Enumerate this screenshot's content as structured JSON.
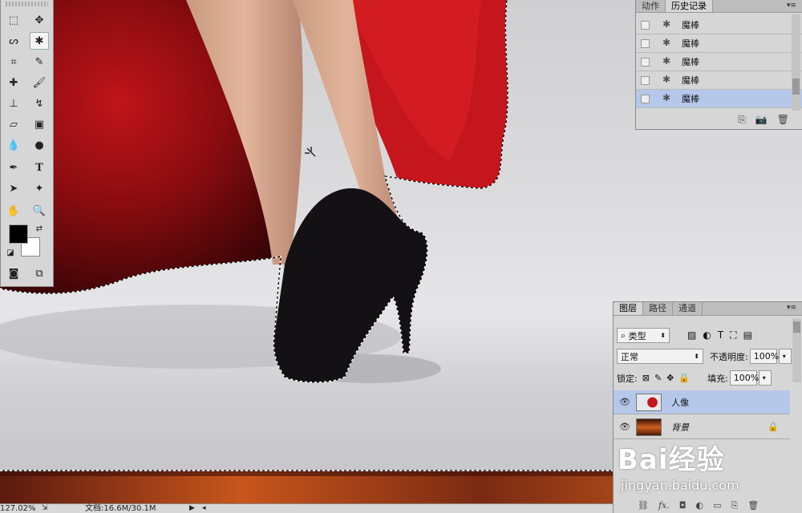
{
  "history_panel": {
    "tabs": [
      "动作",
      "历史记录"
    ],
    "items": [
      "魔棒",
      "魔棒",
      "魔棒",
      "魔棒",
      "魔棒"
    ],
    "selected_index": 4
  },
  "tools_panel": {
    "tools": [
      "marquee-tool",
      "move-tool",
      "lasso-tool",
      "magic-wand-tool",
      "crop-tool",
      "eyedropper-tool",
      "healing-brush-tool",
      "brush-tool",
      "clone-stamp-tool",
      "history-brush-tool",
      "eraser-tool",
      "gradient-tool",
      "blur-tool",
      "dodge-tool",
      "pen-tool",
      "type-tool",
      "path-selection-tool",
      "shape-tool",
      "hand-tool",
      "zoom-tool"
    ],
    "type_tool_glyph": "T",
    "foreground_color": "#000000",
    "background_color": "#ffffff"
  },
  "layers_panel": {
    "tabs": [
      "图层",
      "路径",
      "通道"
    ],
    "filter_kind": "类型",
    "blend_mode": "正常",
    "opacity_label": "不透明度:",
    "opacity_value": "100%",
    "lock_label": "锁定:",
    "fill_label": "填充:",
    "fill_value": "100%",
    "layers": [
      {
        "name": "人像",
        "selected": true
      },
      {
        "name": "背景",
        "selected": false,
        "locked": true
      }
    ],
    "footer_fx": "fx."
  },
  "status_bar": {
    "zoom": "127.02%",
    "doc_info": "文档:16.6M/30.1M"
  },
  "watermark": {
    "brand": "Bai经验",
    "url": "jingyan.baidu.com"
  }
}
